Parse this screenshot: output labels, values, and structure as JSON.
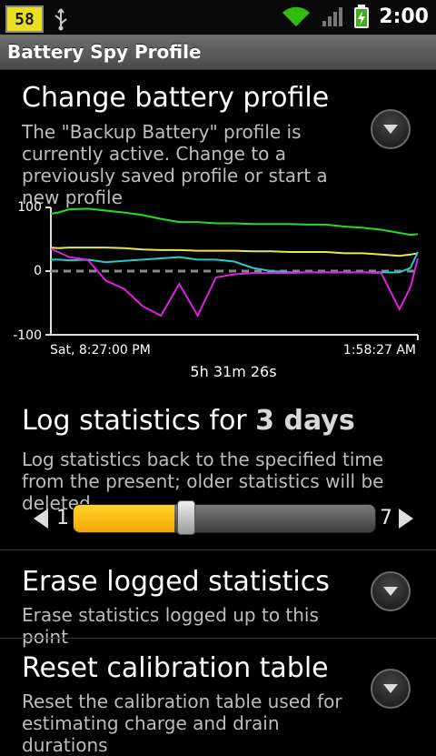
{
  "status_bar": {
    "notification_badge": "58",
    "time": "2:00",
    "icons": [
      "usb-icon",
      "wifi-icon",
      "signal-icon",
      "battery-charging-icon"
    ]
  },
  "app_title": "Battery Spy Profile",
  "profile": {
    "title": "Change battery profile",
    "description": "The \"Backup Battery\" profile is currently active. Change to a previously saved profile or start a new profile"
  },
  "chart_data": {
    "type": "line",
    "ylim": [
      -100,
      100
    ],
    "yticks": [
      "100",
      "0",
      "-100"
    ],
    "x_start_label": "Sat, 8:27:00 PM",
    "x_end_label": "1:58:27 AM",
    "duration_label": "5h 31m 26s",
    "x": [
      0,
      2,
      5,
      10,
      15,
      20,
      25,
      30,
      35,
      40,
      45,
      50,
      55,
      60,
      65,
      70,
      75,
      80,
      85,
      90,
      95,
      98,
      100
    ],
    "series": [
      {
        "color": "#22dd22",
        "values": [
          90,
          92,
          97,
          98,
          95,
          92,
          88,
          82,
          77,
          77,
          75,
          75,
          74,
          74,
          74,
          73,
          73,
          70,
          68,
          65,
          60,
          57,
          58
        ]
      },
      {
        "color": "#e8e84a",
        "values": [
          37,
          36,
          37,
          37,
          37,
          36,
          34,
          33,
          33,
          32,
          32,
          32,
          31,
          31,
          30,
          30,
          30,
          28,
          28,
          26,
          24,
          26,
          28
        ]
      },
      {
        "color": "#22cccc",
        "values": [
          18,
          18,
          17,
          18,
          14,
          16,
          18,
          20,
          22,
          18,
          18,
          15,
          5,
          0,
          -2,
          -2,
          -2,
          -2,
          -2,
          -2,
          -2,
          5,
          30
        ]
      },
      {
        "color": "#dd22dd",
        "values": [
          35,
          30,
          22,
          18,
          -15,
          -28,
          -55,
          -70,
          -20,
          -70,
          -10,
          -5,
          -3,
          -3,
          -3,
          -2,
          -2,
          -2,
          -2,
          -3,
          -60,
          -25,
          20
        ]
      }
    ]
  },
  "log_stats": {
    "title_prefix": "Log statistics for ",
    "title_value": "3 days",
    "description": "Log statistics back to the specified time from the present; older statistics will be deleted",
    "slider_min_label": "1",
    "slider_max_label": "7",
    "min": 1,
    "max": 7,
    "value": 3
  },
  "erase": {
    "title": "Erase logged statistics",
    "description": "Erase statistics logged up to this point"
  },
  "reset": {
    "title": "Reset calibration table",
    "description": "Reset the calibration table used for estimating charge and drain durations"
  }
}
